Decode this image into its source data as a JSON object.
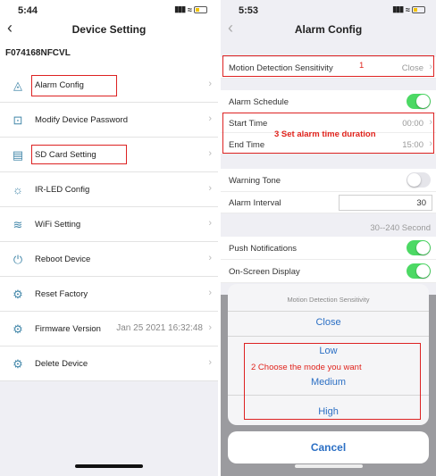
{
  "left": {
    "status": {
      "time": "5:44"
    },
    "nav": {
      "back": "‹",
      "title": "Device Setting"
    },
    "device_id": "F074168NFCVL",
    "items": [
      {
        "label": "Alarm Config",
        "icon": "bell-icon",
        "value": ""
      },
      {
        "label": "Modify Device Password",
        "icon": "lock-icon",
        "value": ""
      },
      {
        "label": "SD Card Setting",
        "icon": "sd-card-icon",
        "value": ""
      },
      {
        "label": "IR-LED Config",
        "icon": "led-icon",
        "value": ""
      },
      {
        "label": "WiFi Setting",
        "icon": "wifi-icon",
        "value": ""
      },
      {
        "label": "Reboot Device",
        "icon": "power-icon",
        "value": ""
      },
      {
        "label": "Reset Factory",
        "icon": "gear-icon",
        "value": ""
      },
      {
        "label": "Firmware Version",
        "icon": "gear-icon",
        "value": "Jan 25 2021 16:32:48"
      },
      {
        "label": "Delete Device",
        "icon": "gear-icon",
        "value": ""
      }
    ]
  },
  "right": {
    "status": {
      "time": "5:53"
    },
    "nav": {
      "back": "‹",
      "title": "Alarm Config"
    },
    "motion": {
      "label": "Motion Detection Sensitivity",
      "value": "Close"
    },
    "annotation_1": "1",
    "schedule": {
      "label": "Alarm Schedule",
      "on": true
    },
    "start": {
      "label": "Start Time",
      "value": "00:00"
    },
    "end": {
      "label": "End Time",
      "value": "15:00"
    },
    "annotation_3": "3 Set alarm time duration",
    "warning_tone": {
      "label": "Warning Tone",
      "on": false
    },
    "interval": {
      "label": "Alarm Interval",
      "value": "30",
      "hint": "30--240 Second"
    },
    "push": {
      "label": "Push Notifications",
      "on": true
    },
    "osd": {
      "label": "On-Screen Display",
      "on": true
    },
    "sheet": {
      "title": "Motion Detection Sensitivity",
      "options": [
        "Close",
        "Low",
        "Medium",
        "High"
      ],
      "cancel": "Cancel"
    },
    "annotation_2": "2 Choose the mode you want"
  },
  "colors": {
    "accent": "#2b6fc4",
    "annotation": "#e0231c",
    "toggle_on": "#4cd964"
  }
}
